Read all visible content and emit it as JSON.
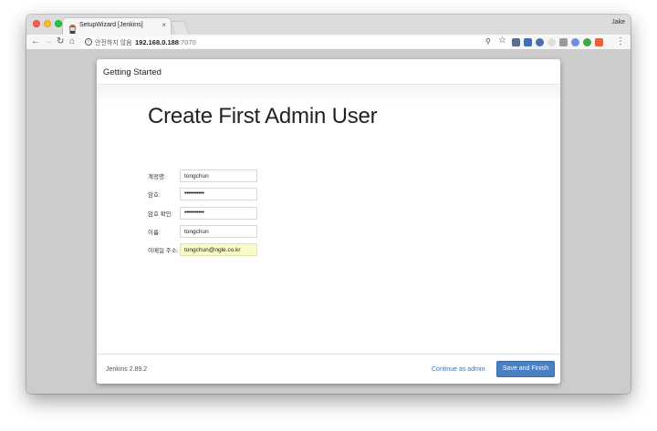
{
  "browser": {
    "tab_title": "SetupWizard [Jenkins]",
    "tab_close": "×",
    "profile_name": "Jake",
    "address": {
      "security_label": "안전하지 않음",
      "host": "192.168.0.188",
      "port": ":7070"
    },
    "extension_colors": [
      "#5b6f8c",
      "#3e6eb5",
      "#4f6fa8",
      "#dedede",
      "#9a9a9a",
      "#6f8fe0",
      "#3ea84a",
      "#e5633f"
    ]
  },
  "modal": {
    "header_title": "Getting Started",
    "heading": "Create First Admin User",
    "fields": [
      {
        "label": "계정명:",
        "value": "tongchun"
      },
      {
        "label": "암호:",
        "value": "•••••••••••"
      },
      {
        "label": "암호 확인:",
        "value": "•••••••••••"
      },
      {
        "label": "이름:",
        "value": "tongchun"
      },
      {
        "label": "이메일 주소:",
        "value": "tongchun@ngle.co.kr"
      }
    ],
    "footer": {
      "version": "Jenkins 2.89.2",
      "continue_link": "Continue as admin",
      "save_button": "Save and Finish"
    }
  }
}
